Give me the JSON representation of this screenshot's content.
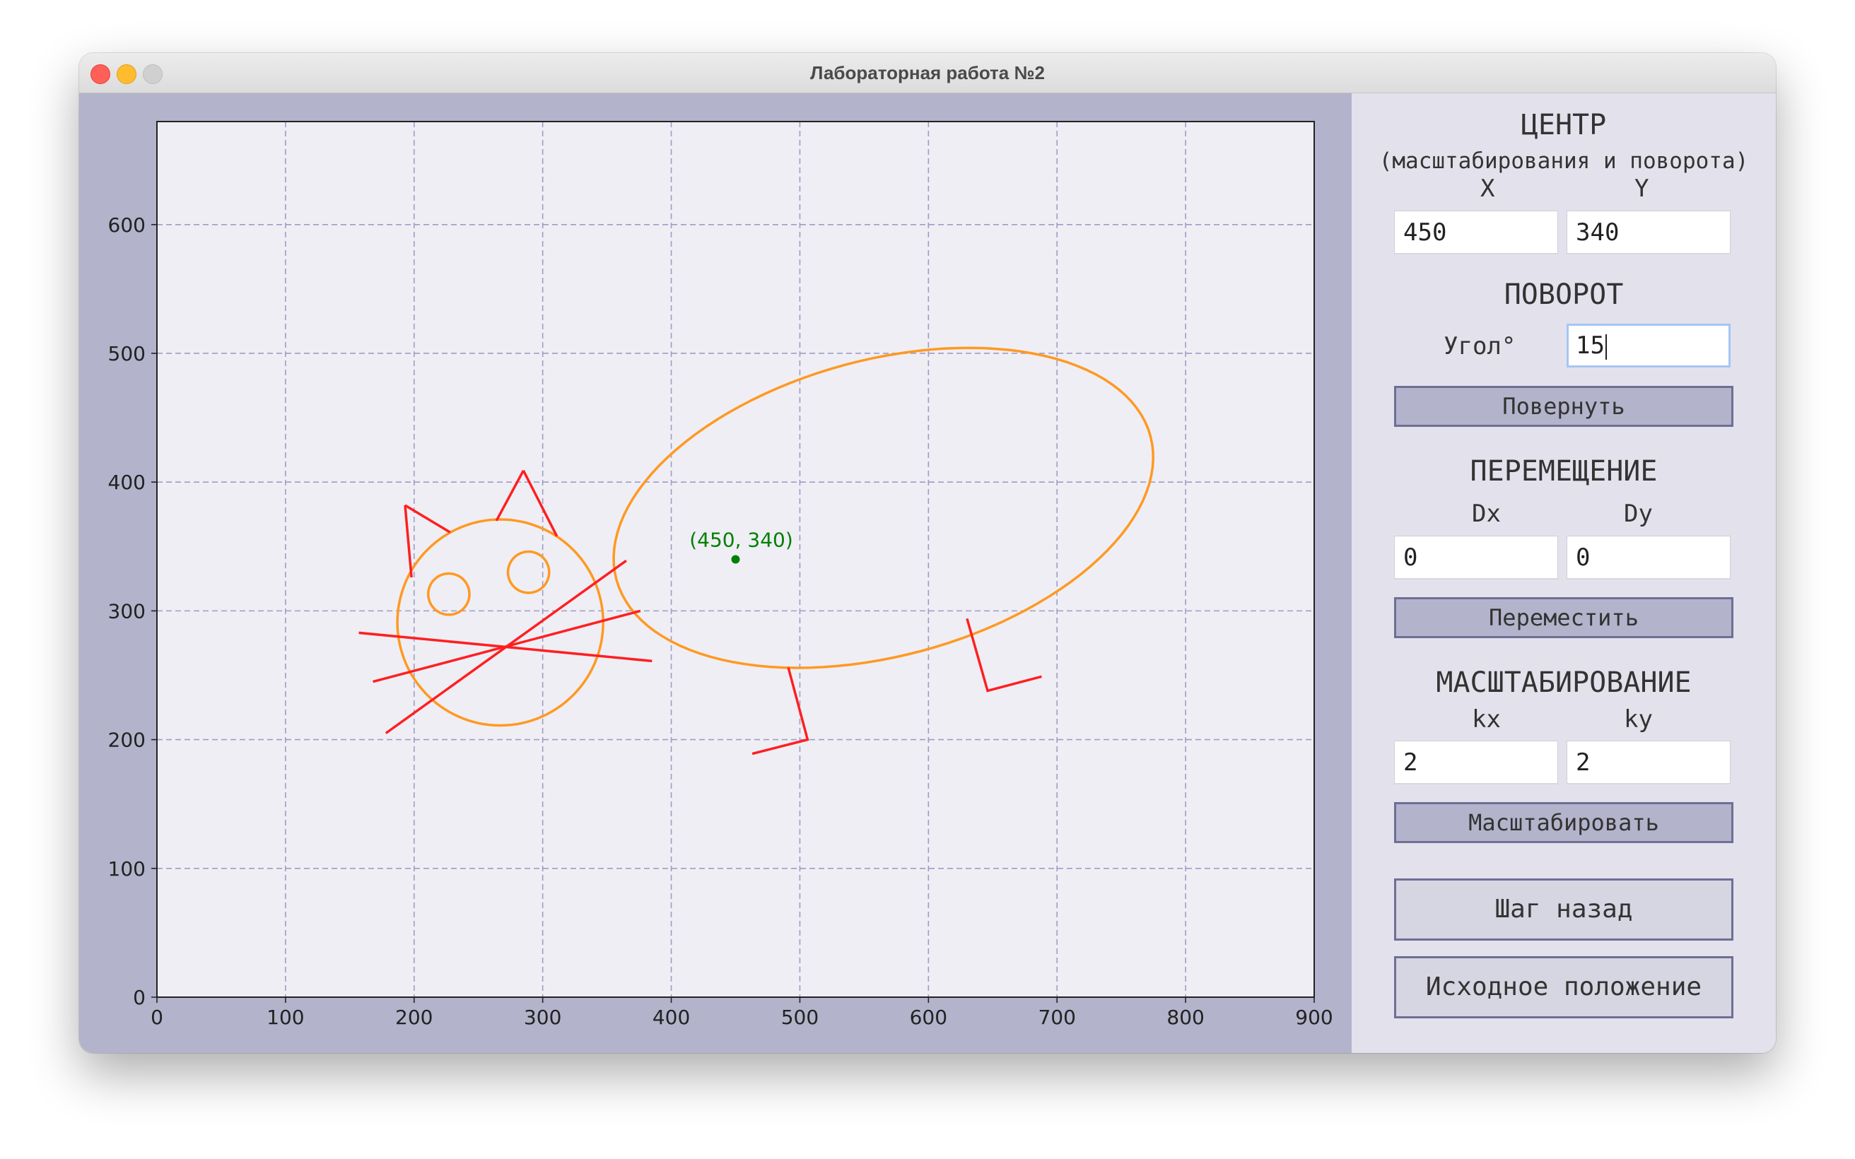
{
  "window": {
    "title": "Лабораторная работа №2"
  },
  "plot": {
    "x_ticks": [
      "0",
      "100",
      "200",
      "300",
      "400",
      "500",
      "600",
      "700",
      "800",
      "900"
    ],
    "y_ticks": [
      "0",
      "100",
      "200",
      "300",
      "400",
      "500",
      "600"
    ],
    "xlim": [
      0,
      900
    ],
    "ylim": [
      0,
      680
    ],
    "grid": true,
    "center_point": {
      "x": 450,
      "y": 340,
      "label": "(450, 340)",
      "color": "#008000"
    },
    "orange_color": "#ff9922",
    "red_color": "#ff1f1f",
    "ellipses": [
      {
        "name": "body",
        "cx": 565,
        "cy": 380,
        "rx": 215,
        "ry": 115,
        "angle": 15
      },
      {
        "name": "head",
        "cx": 267,
        "cy": 291,
        "rx": 80,
        "ry": 80,
        "angle": 0
      },
      {
        "name": "eye-left",
        "cx": 227,
        "cy": 313,
        "rx": 16,
        "ry": 16,
        "angle": 0
      },
      {
        "name": "eye-right",
        "cx": 289,
        "cy": 330,
        "rx": 16,
        "ry": 16,
        "angle": 0
      }
    ],
    "lines": [
      {
        "name": "ear-left",
        "points": [
          [
            193,
            382
          ],
          [
            198,
            326
          ]
        ]
      },
      {
        "name": "ear-left",
        "points": [
          [
            193,
            382
          ],
          [
            228,
            361
          ]
        ]
      },
      {
        "name": "ear-right",
        "points": [
          [
            285,
            409
          ],
          [
            264,
            370
          ]
        ]
      },
      {
        "name": "ear-right",
        "points": [
          [
            285,
            409
          ],
          [
            311,
            358
          ]
        ]
      },
      {
        "name": "whisker",
        "points": [
          [
            157,
            283
          ],
          [
            385,
            261
          ]
        ]
      },
      {
        "name": "whisker",
        "points": [
          [
            168,
            245
          ],
          [
            376,
            300
          ]
        ]
      },
      {
        "name": "whisker",
        "points": [
          [
            178,
            205
          ],
          [
            365,
            339
          ]
        ]
      },
      {
        "name": "leg-left",
        "points": [
          [
            491,
            256
          ],
          [
            506,
            200
          ],
          [
            463,
            189
          ]
        ]
      },
      {
        "name": "leg-right",
        "points": [
          [
            630,
            294
          ],
          [
            646,
            238
          ],
          [
            688,
            249
          ]
        ]
      }
    ]
  },
  "panel": {
    "center_title": "ЦЕНТР",
    "center_subtitle": "(масштабирования и поворота)",
    "x_label": "X",
    "y_label": "Y",
    "center_x": "450",
    "center_y": "340",
    "rotation_title": "ПОВОРОТ",
    "angle_label": "Угол°",
    "angle_value": "15",
    "rotate_button": "Повернуть",
    "move_title": "ПЕРЕМЕЩЕНИЕ",
    "dx_label": "Dx",
    "dy_label": "Dy",
    "dx_value": "0",
    "dy_value": "0",
    "move_button": "Переместить",
    "scale_title": "МАСШТАБИРОВАНИЕ",
    "kx_label": "kx",
    "ky_label": "ky",
    "kx_value": "2",
    "ky_value": "2",
    "scale_button": "Масштабировать",
    "undo_button": "Шаг назад",
    "reset_button": "Исходное положение"
  }
}
